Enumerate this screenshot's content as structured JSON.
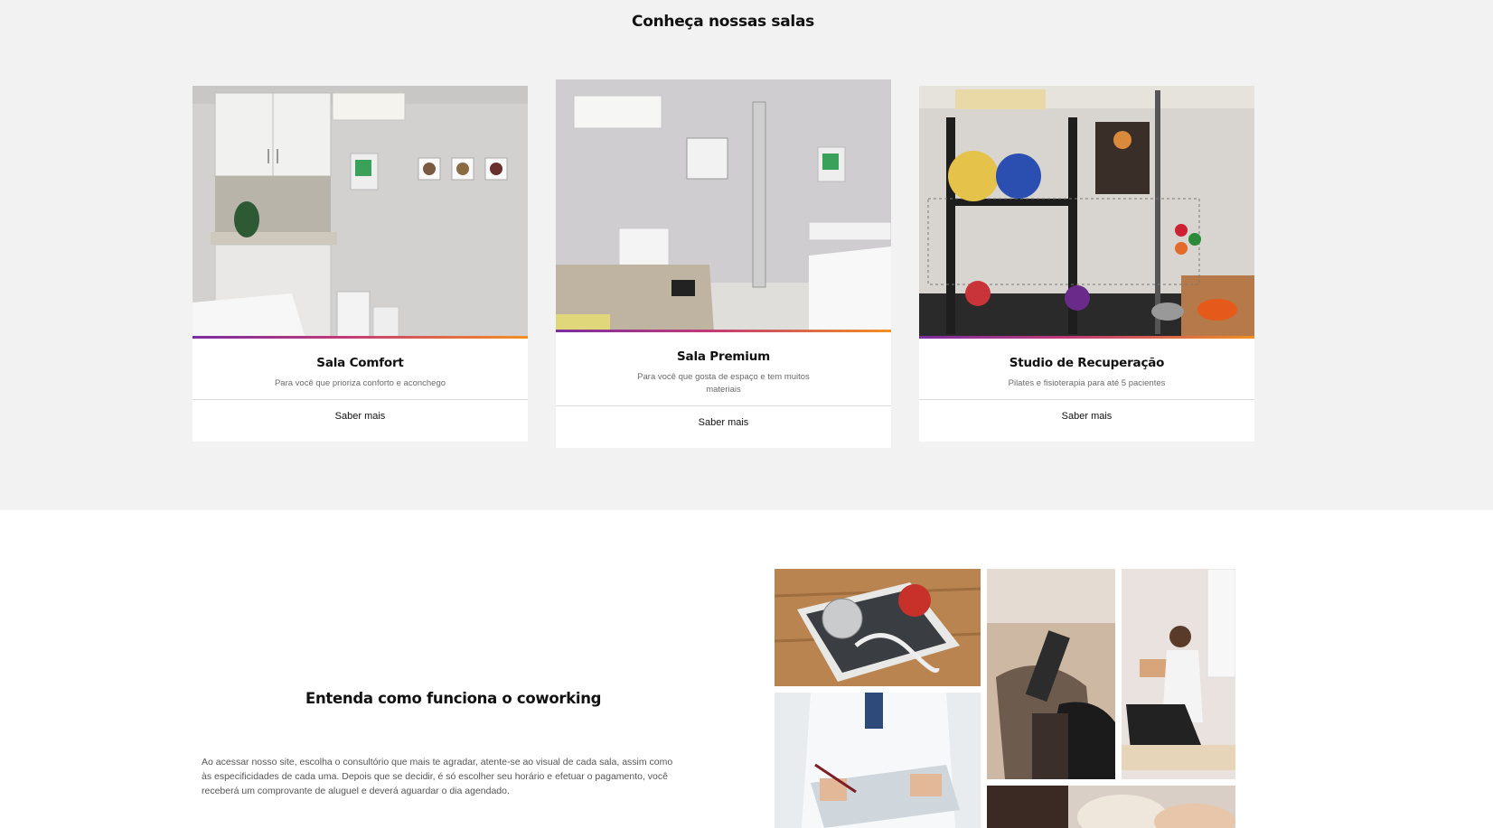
{
  "rooms": {
    "title": "Conheça nossas salas",
    "cards": [
      {
        "title": "Sala Comfort",
        "description": "Para você que prioriza conforto e aconchego",
        "link": "Saber mais",
        "image": "room-photo"
      },
      {
        "title": "Sala Premium",
        "description": "Para você que gosta de espaço e tem muitos materiais",
        "link": "Saber mais",
        "image": "room-photo"
      },
      {
        "title": "Studio de Recuperação",
        "description": "Pilates e fisioterapia para até 5 pacientes",
        "link": "Saber mais",
        "image": "studio-photo"
      }
    ],
    "accent_colors": [
      "#7a2ea0",
      "#c13a78",
      "#f29021"
    ]
  },
  "coworking": {
    "title": "Entenda como funciona o coworking",
    "text": "Ao acessar nosso site, escolha o consultório que mais te agradar, atente-se ao visual de cada sala, assim como às especificidades de cada uma. Depois que se decidir, é só escolher seu horário e efetuar o pagamento, você receberá um comprovante de aluguel e deverá aguardar o dia agendado.",
    "gallery": [
      "scale-photo",
      "tattoo-photo",
      "physio-photo",
      "doctor-photo",
      "spa-photo"
    ]
  },
  "colors": {
    "section_bg": "#f2f2f2",
    "card_bg": "#ffffff",
    "text_dark": "#111111",
    "text_muted": "#6b6b6b"
  }
}
